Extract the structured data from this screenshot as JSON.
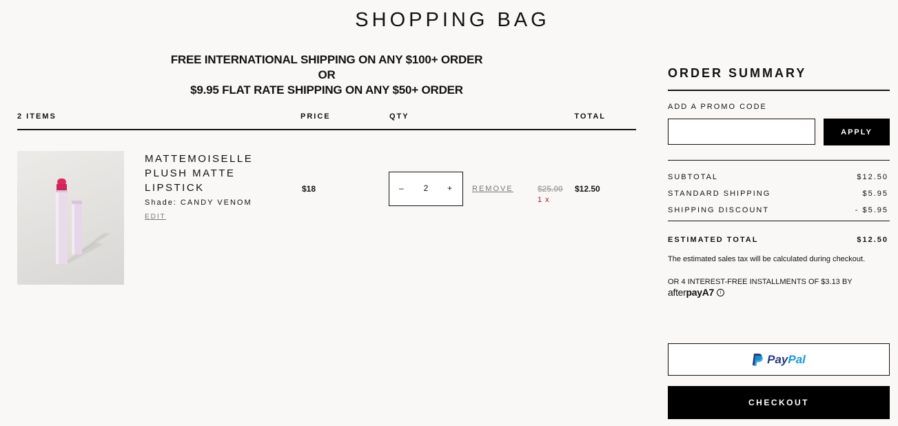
{
  "page": {
    "title": "SHOPPING BAG"
  },
  "banner": {
    "line1": "FREE INTERNATIONAL SHIPPING ON ANY $100+ ORDER",
    "line2": "OR",
    "line3": "$9.95 FLAT RATE SHIPPING ON ANY $50+ ORDER"
  },
  "cart_header": {
    "items_count": "2 ITEMS",
    "price": "PRICE",
    "qty": "QTY",
    "total": "TOTAL"
  },
  "cart_item": {
    "name": "MATTEMOISELLE PLUSH MATTE LIPSTICK",
    "shade": "Shade: CANDY VENOM",
    "edit_label": "EDIT",
    "price": "$18",
    "qty_decrement": "–",
    "qty_value": "2",
    "qty_increment": "+",
    "remove_label": "REMOVE",
    "original_total": "$25.00",
    "sale_total": "$12.50",
    "qty_note": "1 x",
    "image_icon": "lipstick-product-icon",
    "lipstick_color": "#e0275f"
  },
  "summary": {
    "title": "ORDER SUMMARY",
    "promo_label": "ADD A PROMO CODE",
    "promo_value": "",
    "apply_label": "APPLY",
    "subtotal_label": "SUBTOTAL",
    "subtotal_value": "$12.50",
    "shipping_label": "STANDARD SHIPPING",
    "shipping_value": "$5.95",
    "discount_label": "SHIPPING DISCOUNT",
    "discount_value": "- $5.95",
    "estimated_label": "ESTIMATED TOTAL",
    "estimated_value": "$12.50",
    "tax_note": "The estimated sales tax will be calculated during checkout.",
    "installments": "OR 4 INTEREST-FREE INSTALLMENTS OF $3.13 BY",
    "afterpay_after": "after",
    "afterpay_pay": "pay",
    "afterpay_mark": "A7",
    "info_icon_glyph": "i",
    "paypal_pay": "Pay",
    "paypal_pal": "Pal",
    "checkout_label": "CHECKOUT"
  },
  "colors": {
    "background": "#faf8f6",
    "paypal_blue": "#253b80",
    "paypal_light": "#179bd7",
    "sale_red": "#8a1c1c"
  }
}
